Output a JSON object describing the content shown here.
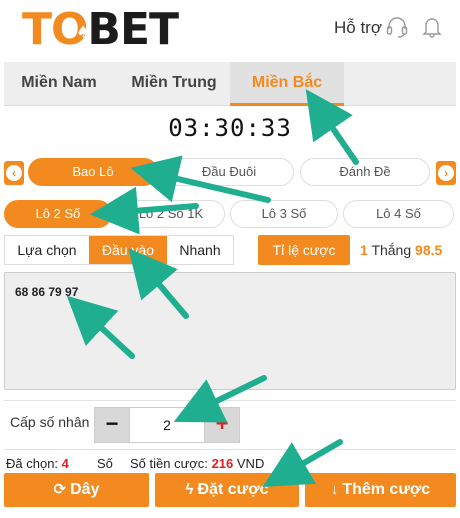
{
  "header": {
    "logo_to": "TO",
    "logo_bet": "BET",
    "support_label": "Hỗ trợ"
  },
  "region_tabs": [
    "Miền Nam",
    "Miền Trung",
    "Miền Bắc"
  ],
  "timer": "03:30:33",
  "bet_types": [
    "Bao Lô",
    "Đầu Đuôi",
    "Đánh Đề"
  ],
  "sub_types": [
    "Lô 2 Số",
    "Lô 2 Số 1K",
    "Lô 3 Số",
    "Lô 4 Số"
  ],
  "input_modes": [
    "Lựa chọn",
    "Đầu vào",
    "Nhanh"
  ],
  "rate": {
    "label": "Tỉ lệ cược",
    "value_left": "1",
    "middle": "Thắng",
    "value_right": "98.5"
  },
  "numbers_text": "68 86 79 97",
  "multiplier": {
    "label": "Cấp số nhân",
    "minus": "−",
    "value": "2",
    "plus": "+"
  },
  "summary": {
    "chosen_label": "Đã chọn:",
    "chosen_value": "4",
    "chosen_unit": "Số",
    "amount_label": "Số tiền cược:",
    "amount_value": "216",
    "amount_unit": "VND"
  },
  "actions": {
    "clear": "Dây",
    "place": "Đặt cược",
    "add": "Thêm cược"
  },
  "colors": {
    "accent": "#f28a1f",
    "annotation_arrow": "#1fae8f",
    "error_red": "#e02020"
  },
  "icons": [
    "headset-icon",
    "bell-icon",
    "chevron-left-icon",
    "chevron-right-icon",
    "refresh-icon",
    "bolt-icon",
    "arrow-down-icon"
  ]
}
